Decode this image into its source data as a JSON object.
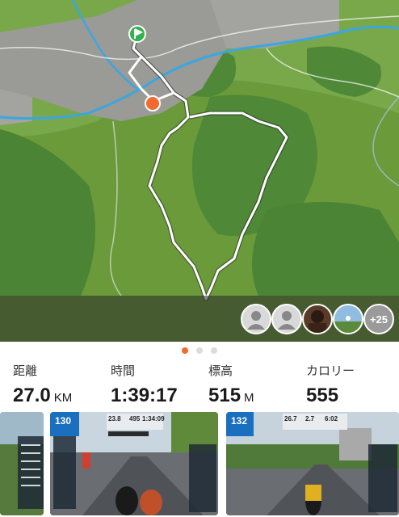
{
  "map": {
    "start_marker_icon": "start-flag-icon",
    "end_marker_icon": "finish-dot-icon",
    "colors": {
      "grass": "#6a9a3a",
      "forest": "#3f7a2e",
      "river": "#3ba6e0",
      "route": "#ffffff",
      "start": "#2fb34a",
      "end": "#f26a2e"
    }
  },
  "athletes": {
    "avatars": [
      "default-user-icon",
      "default-user-icon",
      "athlete-photo",
      "athlete-photo"
    ],
    "more_label": "+25"
  },
  "pager": {
    "pages": 3,
    "active": 0
  },
  "stats": [
    {
      "label": "距離",
      "value": "27.0",
      "unit": "KM"
    },
    {
      "label": "時間",
      "value": "1:39:17",
      "unit": ""
    },
    {
      "label": "標高",
      "value": "515",
      "unit": "M"
    },
    {
      "label": "カロリー",
      "value": "555",
      "unit": ""
    }
  ],
  "screenshots": {
    "items": [
      {
        "power": "130",
        "speed": "23.8",
        "distance": "495",
        "time": "1:34:09"
      },
      {
        "power": "132",
        "speed": "26.7",
        "distance": "2.7",
        "time": "6:02"
      }
    ]
  }
}
